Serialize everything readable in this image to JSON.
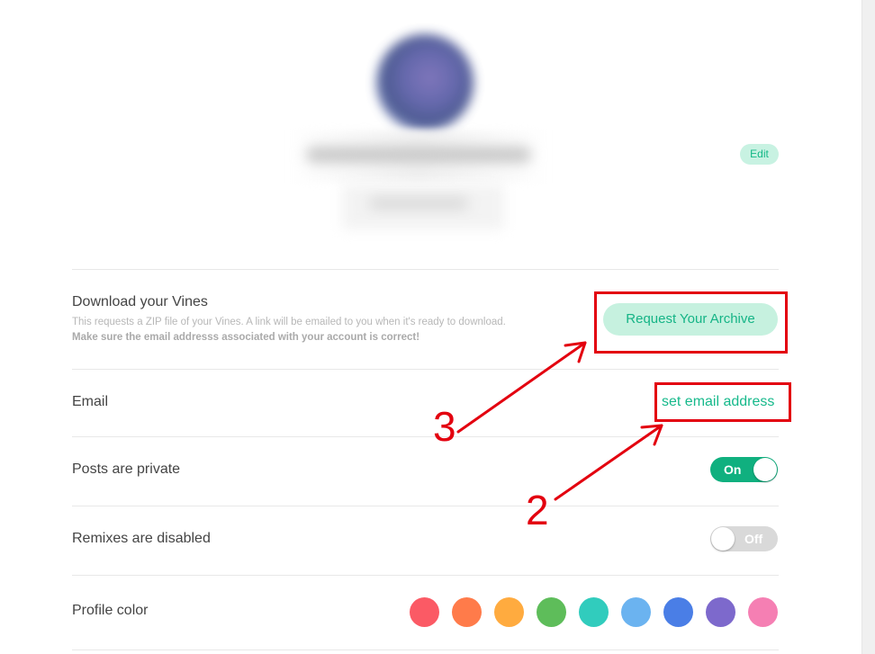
{
  "profile": {
    "edit_label": "Edit"
  },
  "download": {
    "title": "Download your Vines",
    "description": "This requests a ZIP file of your Vines. A link will be emailed to you when it's ready to download.",
    "warning": "Make sure the email addresss associated with your account is correct!",
    "button_label": "Request Your Archive"
  },
  "email": {
    "title": "Email",
    "link_label": "set email address"
  },
  "privacy": {
    "title": "Posts are private",
    "toggle_label": "On",
    "state": true
  },
  "remixes": {
    "title": "Remixes are disabled",
    "toggle_label": "Off",
    "state": false
  },
  "profile_color": {
    "title": "Profile color",
    "swatches": [
      "#fb5a65",
      "#ff7b4a",
      "#ffab3f",
      "#5ebd5a",
      "#31ccbd",
      "#6bb3f0",
      "#4a7ee6",
      "#7d69cc",
      "#f57fb3"
    ]
  },
  "annotations": {
    "color": "#e3000f",
    "step_2": "2",
    "step_3": "3"
  },
  "colors": {
    "accent": "#10b07f",
    "accent_light": "#c6f1df"
  }
}
